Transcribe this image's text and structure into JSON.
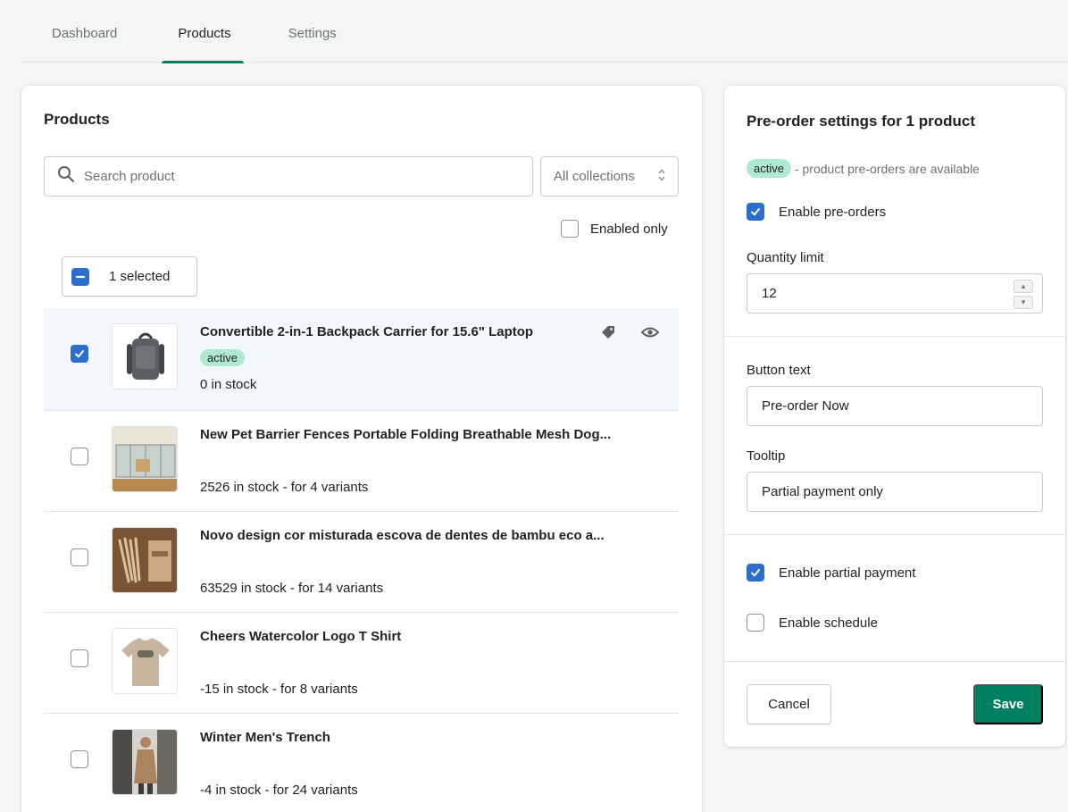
{
  "tabs": [
    {
      "label": "Dashboard"
    },
    {
      "label": "Products"
    },
    {
      "label": "Settings"
    }
  ],
  "products_panel": {
    "title": "Products",
    "search_placeholder": "Search product",
    "collections_filter": "All collections",
    "enabled_only_label": "Enabled only",
    "bulk_selection_label": "1 selected",
    "rows": [
      {
        "title": "Convertible 2-in-1 Backpack Carrier for 15.6\" Laptop",
        "status": "active",
        "stock": "0 in stock",
        "checked": true
      },
      {
        "title": "New Pet Barrier Fences Portable Folding Breathable Mesh Dog...",
        "stock": "2526 in stock - for 4 variants",
        "checked": false
      },
      {
        "title": "Novo design cor misturada escova de dentes de bambu eco a...",
        "stock": "63529 in stock - for 14 variants",
        "checked": false
      },
      {
        "title": "Cheers Watercolor Logo T Shirt",
        "stock": "-15 in stock - for 8 variants",
        "checked": false
      },
      {
        "title": "Winter Men's Trench",
        "stock": "-4 in stock - for 24 variants",
        "checked": false
      }
    ]
  },
  "settings_panel": {
    "title": "Pre-order settings for 1 product",
    "status_badge": "active",
    "status_text": "- product pre-orders are available",
    "enable_preorders_label": "Enable pre-orders",
    "quantity_limit_label": "Quantity limit",
    "quantity_limit_value": "12",
    "button_text_label": "Button text",
    "button_text_value": "Pre-order Now",
    "tooltip_label": "Tooltip",
    "tooltip_value": "Partial payment only",
    "enable_partial_payment_label": "Enable partial payment",
    "enable_schedule_label": "Enable schedule",
    "cancel_label": "Cancel",
    "save_label": "Save"
  },
  "colors": {
    "accent": "#008060",
    "checkbox": "#2c6ecb",
    "badge": "#aee9d1"
  }
}
